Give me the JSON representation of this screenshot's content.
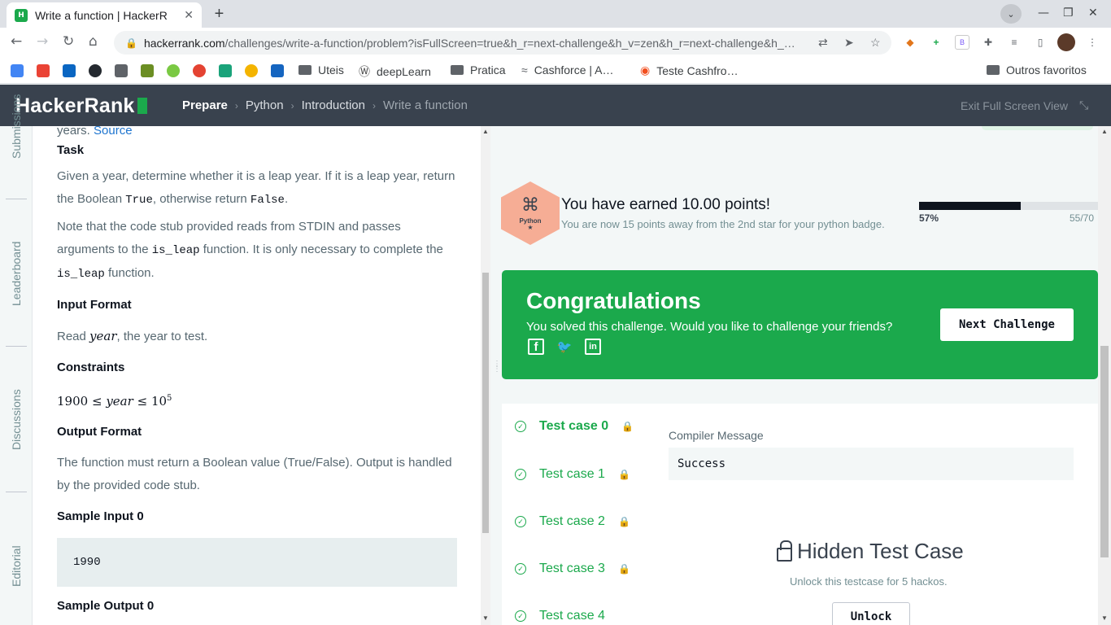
{
  "browser": {
    "tab_title": "Write a function | HackerR",
    "url_host": "hackerrank.com",
    "url_path": "/challenges/write-a-function/problem?isFullScreen=true&h_r=next-challenge&h_v=zen&h_r=next-challenge&h_…",
    "new_tab_symbol": "+",
    "bookmarks": [
      "Uteis",
      "deepLearn",
      "Pratica",
      "Cashforce | A…",
      "Teste Cashfro…"
    ],
    "other_bookmarks": "Outros favoritos"
  },
  "header": {
    "logo": "HackerRank",
    "breadcrumbs": [
      "Prepare",
      "Python",
      "Introduction",
      "Write a function"
    ],
    "exit_fullscreen": "Exit Full Screen View"
  },
  "side_tabs": [
    "Submissions",
    "Leaderboard",
    "Discussions",
    "Editorial"
  ],
  "problem": {
    "intro_tail": "years.",
    "intro_link": "Source",
    "task_heading": "Task",
    "task_text_1": "Given a year, determine whether it is a leap year. If it is a leap year, return the Boolean",
    "task_true": "True",
    "task_text_2": ", otherwise return",
    "task_false": "False",
    "note_1": "Note that the code stub provided reads from STDIN and passes arguments to the",
    "note_fn1": "is_leap",
    "note_2": "function. It is only necessary to complete the",
    "note_fn2": "is_leap",
    "note_3": "function.",
    "input_heading": "Input Format",
    "input_pre": "Read",
    "input_var": "year",
    "input_post": ", the year to test.",
    "constraints_heading": "Constraints",
    "constraint_low": "1900",
    "constraint_le": "≤",
    "constraint_var": "year",
    "constraint_high": "10",
    "constraint_exp": "5",
    "output_heading": "Output Format",
    "output_text": "The function must return a Boolean value (True/False). Output is handled by the provided code stub.",
    "sample_input_heading": "Sample Input 0",
    "sample_input_value": "1990",
    "sample_output_heading": "Sample Output 0"
  },
  "result": {
    "badge_label": "Python",
    "earned_title": "You have earned 10.00 points!",
    "earned_sub": "You are now 15 points away from the 2nd star for your python badge.",
    "progress_percent_label": "57%",
    "progress_percent": 57,
    "progress_points": "55/70",
    "congrats_title": "Congratulations",
    "congrats_sub": "You solved this challenge. Would you like to challenge your friends?",
    "next_challenge": "Next Challenge",
    "test_cases": [
      "Test case 0",
      "Test case 1",
      "Test case 2",
      "Test case 3",
      "Test case 4"
    ],
    "compiler_label": "Compiler Message",
    "compiler_message": "Success",
    "hidden_title": "Hidden Test Case",
    "hidden_sub": "Unlock this testcase for 5 hackos.",
    "unlock": "Unlock"
  },
  "colors": {
    "brand_green": "#1ba94c",
    "header_dark": "#39424e",
    "badge_orange": "#f6ad95"
  }
}
